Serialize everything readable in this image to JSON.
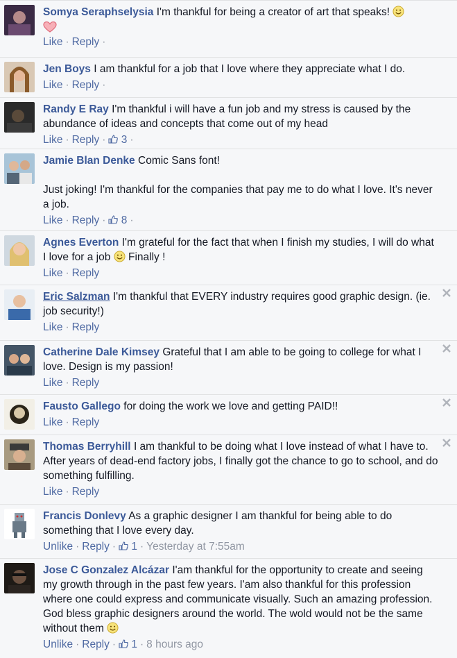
{
  "comments": [
    {
      "author": "Somya Seraphselysia",
      "text": "I'm thankful for being a creator of art that speaks!",
      "like": "Like",
      "reply": "Reply",
      "sep": "·"
    },
    {
      "author": "Jen Boys",
      "text": "I am thankful for a job that I love where they appreciate what I do.",
      "like": "Like",
      "reply": "Reply",
      "sep": "·"
    },
    {
      "author": "Randy E Ray",
      "text": "I'm thankful i will have a fun job and my stress is caused by the abundance of ideas and concepts that come out of my head",
      "like": "Like",
      "reply": "Reply",
      "likes": "3",
      "sep": "·"
    },
    {
      "author": "Jamie Blan Denke",
      "text": "Comic Sans font!",
      "text2": "Just joking! I'm thankful for the companies that pay me to do what I love. It's never a job.",
      "like": "Like",
      "reply": "Reply",
      "likes": "8",
      "sep": "·"
    },
    {
      "author": "Agnes Everton",
      "text": "I'm grateful for the fact that when I finish my studies, I will do what I love for a job",
      "text_after": "Finally !",
      "like": "Like",
      "reply": "Reply",
      "sep": "·"
    },
    {
      "author": "Eric Salzman",
      "text": "I'm thankful that EVERY industry requires good graphic design. (ie. job security!)",
      "like": "Like",
      "reply": "Reply",
      "sep": "·"
    },
    {
      "author": "Catherine Dale Kimsey",
      "text": "Grateful that I am able to be going to college for what I love. Design is my passion!",
      "like": "Like",
      "reply": "Reply",
      "sep": "·"
    },
    {
      "author": "Fausto Gallego",
      "text": "for doing the work we love and getting PAID!!",
      "like": "Like",
      "reply": "Reply",
      "sep": "·"
    },
    {
      "author": "Thomas Berryhill",
      "text": "I am thankful to be doing what I love instead of what I have to. After years of dead-end factory jobs, I finally got the chance to go to school, and do something fulfilling.",
      "like": "Like",
      "reply": "Reply",
      "sep": "·"
    },
    {
      "author": "Francis Donlevy",
      "text": "As a graphic designer I am thankful for being able to do something that I love every day.",
      "like": "Unlike",
      "reply": "Reply",
      "likes": "1",
      "time": "Yesterday at 7:55am",
      "sep": "·"
    },
    {
      "author": "Jose C Gonzalez Alcázar",
      "text": "I'am thankful for the opportunity to create and seeing my growth through in the past few years. I'am also thankful for this profession where one could express and communicate visually. Such an amazing profession. God bless graphic designers around the world. The wold would not be the same without them",
      "like": "Unlike",
      "reply": "Reply",
      "likes": "1",
      "time": "8 hours ago",
      "sep": "·"
    }
  ],
  "colors": {
    "link": "#3b5998",
    "action": "#4e69a2",
    "meta": "#9197a3",
    "background": "#f6f7f9",
    "border": "#e1e2e3"
  },
  "icons": {
    "smiley": "smiley-emoji-icon",
    "heart": "heart-emoji-icon",
    "thumb": "thumbs-up-icon",
    "close": "close-icon"
  }
}
